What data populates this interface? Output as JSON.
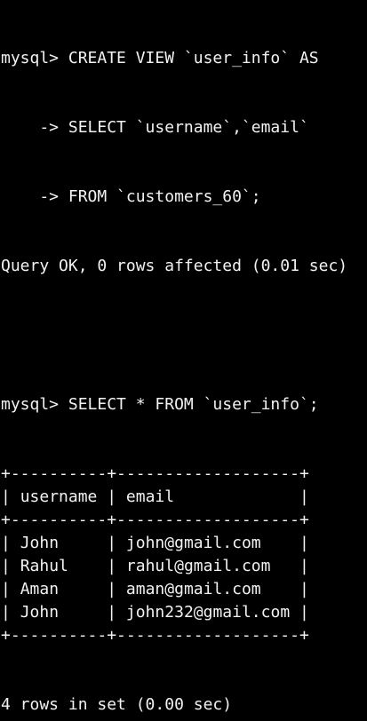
{
  "terminal": {
    "prompt": "mysql> ",
    "continuation": "    -> ",
    "create_lines": [
      "CREATE VIEW `user_info` AS",
      "SELECT `username`,`email`",
      "FROM `customers_60`;"
    ],
    "create_result": "Query OK, 0 rows affected (0.01 sec)",
    "select_command": "SELECT * FROM `user_info`;",
    "table": {
      "headers": [
        "username",
        "email"
      ],
      "rows": [
        [
          "John",
          "john@gmail.com"
        ],
        [
          "Rahul",
          "rahul@gmail.com"
        ],
        [
          "Aman",
          "aman@gmail.com"
        ],
        [
          "John",
          "john232@gmail.com"
        ]
      ]
    },
    "select_result": "4 rows in set (0.00 sec)"
  }
}
